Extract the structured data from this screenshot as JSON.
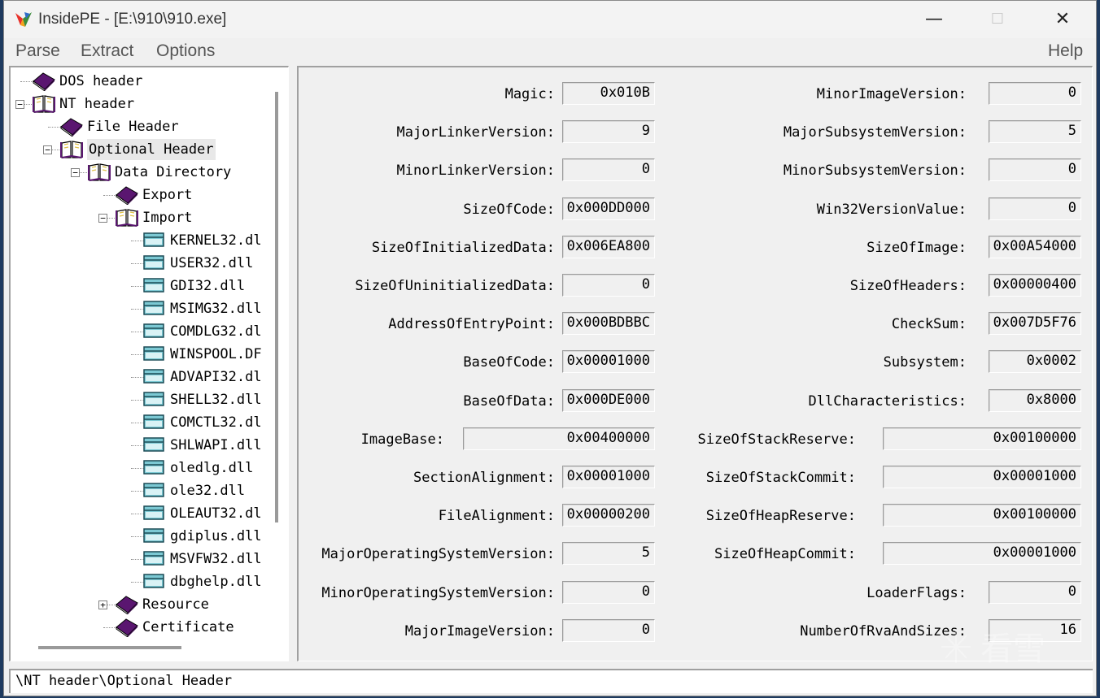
{
  "window": {
    "title": "InsidePE - [E:\\910\\910.exe]",
    "minimize_glyph": "—",
    "maximize_glyph": "☐",
    "close_glyph": "✕"
  },
  "menu": {
    "parse": "Parse",
    "extract": "Extract",
    "options": "Options",
    "help": "Help"
  },
  "tree": [
    {
      "label": "DOS header",
      "icon": "book-icon"
    },
    {
      "label": "NT header",
      "icon": "open-book-icon",
      "expander": "⊟"
    },
    {
      "label": "File Header",
      "icon": "book-icon"
    },
    {
      "label": "Optional Header",
      "icon": "open-book-icon",
      "expander": "⊟",
      "selected": true
    },
    {
      "label": "Data Directory",
      "icon": "open-book-icon",
      "expander": "⊟"
    },
    {
      "label": "Export",
      "icon": "book-icon"
    },
    {
      "label": "Import",
      "icon": "open-book-icon",
      "expander": "⊟"
    },
    {
      "label": "KERNEL32.dl",
      "icon": "page-icon"
    },
    {
      "label": "USER32.dll",
      "icon": "page-icon"
    },
    {
      "label": "GDI32.dll",
      "icon": "page-icon"
    },
    {
      "label": "MSIMG32.dll",
      "icon": "page-icon"
    },
    {
      "label": "COMDLG32.dl",
      "icon": "page-icon"
    },
    {
      "label": "WINSPOOL.DF",
      "icon": "page-icon"
    },
    {
      "label": "ADVAPI32.dl",
      "icon": "page-icon"
    },
    {
      "label": "SHELL32.dll",
      "icon": "page-icon"
    },
    {
      "label": "COMCTL32.dl",
      "icon": "page-icon"
    },
    {
      "label": "SHLWAPI.dll",
      "icon": "page-icon"
    },
    {
      "label": "oledlg.dll",
      "icon": "page-icon"
    },
    {
      "label": "ole32.dll",
      "icon": "page-icon"
    },
    {
      "label": "OLEAUT32.dl",
      "icon": "page-icon"
    },
    {
      "label": "gdiplus.dll",
      "icon": "page-icon"
    },
    {
      "label": "MSVFW32.dll",
      "icon": "page-icon"
    },
    {
      "label": "dbghelp.dll",
      "icon": "page-icon"
    },
    {
      "label": "Resource",
      "icon": "book-icon",
      "expander": "⊞"
    },
    {
      "label": "Certificate",
      "icon": "book-icon"
    }
  ],
  "fields_left": [
    {
      "label": "Magic:",
      "value": "0x010B"
    },
    {
      "label": "MajorLinkerVersion:",
      "value": "9"
    },
    {
      "label": "MinorLinkerVersion:",
      "value": "0"
    },
    {
      "label": "SizeOfCode:",
      "value": "0x000DD000"
    },
    {
      "label": "SizeOfInitializedData:",
      "value": "0x006EA800"
    },
    {
      "label": "SizeOfUninitializedData:",
      "value": "0"
    },
    {
      "label": "AddressOfEntryPoint:",
      "value": "0x000BDBBC"
    },
    {
      "label": "BaseOfCode:",
      "value": "0x00001000"
    },
    {
      "label": "BaseOfData:",
      "value": "0x000DE000"
    },
    {
      "label": "ImageBase:",
      "value": "0x00400000"
    },
    {
      "label": "SectionAlignment:",
      "value": "0x00001000"
    },
    {
      "label": "FileAlignment:",
      "value": "0x00000200"
    },
    {
      "label": "MajorOperatingSystemVersion:",
      "value": "5"
    },
    {
      "label": "MinorOperatingSystemVersion:",
      "value": "0"
    },
    {
      "label": "MajorImageVersion:",
      "value": "0"
    }
  ],
  "fields_right": [
    {
      "label": "MinorImageVersion:",
      "value": "0"
    },
    {
      "label": "MajorSubsystemVersion:",
      "value": "5"
    },
    {
      "label": "MinorSubsystemVersion:",
      "value": "0"
    },
    {
      "label": "Win32VersionValue:",
      "value": "0"
    },
    {
      "label": "SizeOfImage:",
      "value": "0x00A54000"
    },
    {
      "label": "SizeOfHeaders:",
      "value": "0x00000400"
    },
    {
      "label": "CheckSum:",
      "value": "0x007D5F76"
    },
    {
      "label": "Subsystem:",
      "value": "0x0002"
    },
    {
      "label": "DllCharacteristics:",
      "value": "0x8000"
    },
    {
      "label": "SizeOfStackReserve:",
      "value": "0x00100000"
    },
    {
      "label": "SizeOfStackCommit:",
      "value": "0x00001000"
    },
    {
      "label": "SizeOfHeapReserve:",
      "value": "0x00100000"
    },
    {
      "label": "SizeOfHeapCommit:",
      "value": "0x00001000"
    },
    {
      "label": "LoaderFlags:",
      "value": "0"
    },
    {
      "label": "NumberOfRvaAndSizes:",
      "value": "16"
    }
  ],
  "status": {
    "path": "\\NT header\\Optional Header"
  },
  "watermark": {
    "text": "看雪"
  },
  "colors": {
    "book": "#5a1670",
    "page": "#7cc9d4",
    "selection": "#e8e8e8"
  }
}
